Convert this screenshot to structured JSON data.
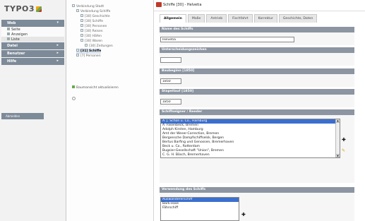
{
  "app": {
    "logo": "TYPO3"
  },
  "modules": [
    {
      "label": "Web",
      "items": [
        "Seite",
        "Anzeigen",
        "Liste"
      ]
    },
    {
      "label": "Datei",
      "items": []
    },
    {
      "label": "Benutzer",
      "items": []
    },
    {
      "label": "Hilfe",
      "items": []
    }
  ],
  "logout_label": "Abmelden",
  "tree": {
    "rows": [
      {
        "label": "Verbindung Stadt",
        "depth": 0
      },
      {
        "label": "Verbindung Schiffe",
        "depth": 1
      },
      {
        "label": "[30] Geschichte",
        "depth": 2
      },
      {
        "label": "[30] Schiffe",
        "depth": 2
      },
      {
        "label": "[30] Personen",
        "depth": 2
      },
      {
        "label": "[30] Reisen",
        "depth": 2
      },
      {
        "label": "[30] Häfen",
        "depth": 2
      },
      {
        "label": "[30] Waren",
        "depth": 2
      },
      {
        "label": "[30] Zeitungen",
        "depth": 3
      },
      {
        "label": "[31] Schiffe",
        "depth": 1,
        "selected": true
      },
      {
        "label": "[7] Personen",
        "depth": 1
      }
    ],
    "status": "Baumansicht aktualisieren"
  },
  "record": {
    "title": "Schiffe [30] - Helvetia",
    "tabs": [
      "Allgemein",
      "Maße",
      "Antrieb",
      "Fischfahrt",
      "Korrektur",
      "Geschichte, Daten"
    ],
    "active_tab": 0,
    "sections": {
      "name": {
        "label": "Name des Schiffs",
        "value": "Helvetia"
      },
      "ident": {
        "label": "Unterscheidungszeichen",
        "value": ""
      },
      "built": {
        "label": "Baubeginn [1850]",
        "value": "1850"
      },
      "launched": {
        "label": "Stapellauf [1850]",
        "value": "1850"
      },
      "owners": {
        "label": "Schiffseigner / Reeder",
        "options": [
          "A. J. Schön u. Co., Hamburg",
          "A. Fasenbeck, Bremen",
          "Adolph Kirsten, Hamburg",
          "Amt der Weser-Correction, Bremen",
          "Bergensche Dampfschiffselsk, Bergen",
          "Bertus Barfing und Genossen, Bremerhaven",
          "Beck u. Co., Rotterdam",
          "Bugsier-Gesellschaft \"Union\", Bremen",
          "C. G. H. Bösch, Bremerhaven"
        ],
        "selected": 0
      },
      "use": {
        "label": "Verwendung des Schiffs",
        "options": [
          "Auswandererschiff",
          "Bark-ease",
          "Fährschiff"
        ],
        "selected": 0
      }
    }
  }
}
